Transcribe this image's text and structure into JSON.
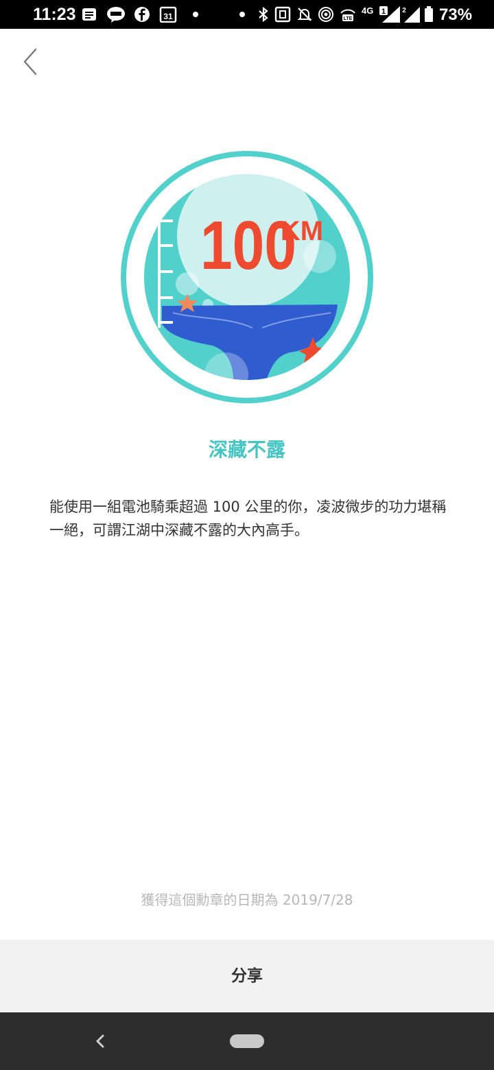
{
  "status_bar": {
    "time": "11:23",
    "battery_percent": "73%",
    "network": "4G",
    "sim1": "1",
    "sim2": "2",
    "volte": "VoLTE"
  },
  "badge": {
    "distance_value": "100",
    "distance_unit": "KM",
    "title": "深藏不露",
    "description": "能使用一組電池騎乘超過 100 公里的你，凌波微步的功力堪稱一絕，可謂江湖中深藏不露的大內高手。"
  },
  "earned_date_text": "獲得這個勳章的日期為 2019/7/28",
  "share_label": "分享",
  "colors": {
    "accent": "#45c4c4",
    "distance_text": "#ee4a2f",
    "whale_tail": "#2f5ccf",
    "ocean": "#52d0cc"
  }
}
